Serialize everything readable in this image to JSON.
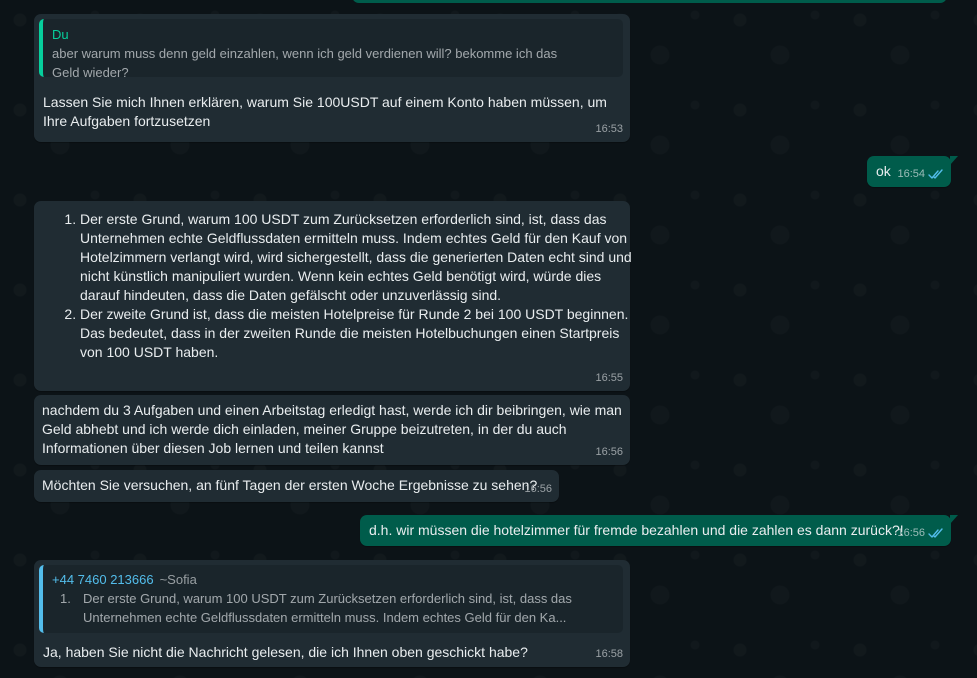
{
  "messages": [
    {
      "quote_author": "Du",
      "quote_text": "aber warum muss denn geld einzahlen, wenn ich geld verdienen will? bekomme ich das Geld wieder?",
      "text": "Lassen Sie mich Ihnen erklären, warum Sie 100USDT auf einem Konto haben müssen, um Ihre Aufgaben fortzusetzen",
      "time": "16:53"
    },
    {
      "text": "ok",
      "time": "16:54"
    },
    {
      "list": [
        "Der erste Grund, warum 100 USDT zum Zurücksetzen erforderlich sind, ist, dass das Unternehmen echte Geldflussdaten ermitteln muss. Indem echtes Geld für den Kauf von Hotelzimmern verlangt wird, wird sichergestellt, dass die generierten Daten echt sind und nicht künstlich manipuliert wurden. Wenn kein echtes Geld benötigt wird, würde dies darauf hindeuten, dass die Daten gefälscht oder unzuverlässig sind.",
        "Der zweite Grund ist, dass die meisten Hotelpreise für Runde 2 bei 100 USDT beginnen. Das bedeutet, dass in der zweiten Runde die meisten Hotelbuchungen einen Startpreis von 100 USDT haben."
      ],
      "time": "16:55"
    },
    {
      "text": "nachdem du 3 Aufgaben und einen Arbeitstag erledigt hast, werde ich dir beibringen, wie man Geld abhebt und ich werde dich einladen, meiner Gruppe beizutreten, in der du auch Informationen über diesen Job lernen und teilen kannst",
      "time": "16:56"
    },
    {
      "text": "Möchten Sie versuchen, an fünf Tagen der ersten Woche Ergebnisse zu sehen?",
      "time": "16:56"
    },
    {
      "text": "d.h. wir müssen die hotelzimmer für fremde bezahlen und die zahlen es dann zurück?!",
      "time": "16:56"
    },
    {
      "quote_author": "+44 7460 213666",
      "quote_alias": "~Sofia",
      "quote_item_number": "1.",
      "quote_text": "Der erste Grund, warum 100 USDT zum Zurücksetzen erforderlich sind, ist, dass das Unternehmen echte Geldflussdaten ermitteln muss. Indem echtes Geld für den Ka...",
      "text": "Ja, haben Sie nicht die Nachricht gelesen, die ich Ihnen oben geschickt habe?",
      "time": "16:58"
    }
  ],
  "colors": {
    "incoming_bubble": "#202c33",
    "outgoing_bubble": "#005c4b",
    "read_receipt": "#53bdeb",
    "quote_self": "#06cf9c",
    "quote_other": "#53bdeb"
  },
  "icons": {
    "read_receipt": "double-check-icon"
  }
}
